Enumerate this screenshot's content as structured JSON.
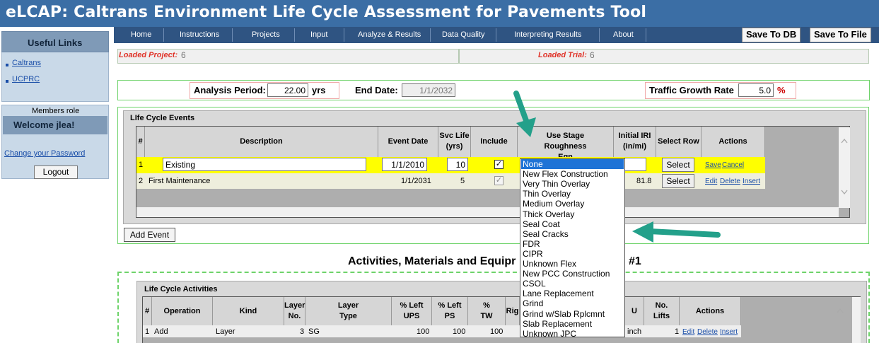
{
  "app": {
    "title": "eLCAP: Caltrans Environment Life Cycle Assessment for Pavements Tool"
  },
  "nav": {
    "items": [
      "Home",
      "Instructions",
      "Projects",
      "Input",
      "Analyze & Results",
      "Data Quality",
      "Interpreting Results",
      "About"
    ],
    "save_db": "Save To DB",
    "save_file": "Save To File"
  },
  "sidebar": {
    "useful_links_title": "Useful Links",
    "links": [
      "Caltrans",
      "UCPRC"
    ],
    "members_role": "Members role",
    "welcome": "Welcome jlea!",
    "change_password": "Change your Password",
    "logout": "Logout"
  },
  "loaded": {
    "project_label": "Loaded Project:",
    "project_value": "6",
    "trial_label": "Loaded Trial:",
    "trial_value": "6"
  },
  "analysis": {
    "period_label": "Analysis Period:",
    "period_value": "22.00",
    "period_unit": "yrs",
    "end_date_label": "End Date:",
    "end_date_value": "1/1/2032",
    "growth_label": "Traffic Growth Rate",
    "growth_value": "5.0",
    "growth_unit": "%"
  },
  "events": {
    "legend": "LIfe Cycle Events",
    "headers": {
      "num": "#",
      "description": "Description",
      "event_date": "Event Date",
      "svc_life": "Svc Life (yrs)",
      "include": "Include",
      "roughness": "Use Stage Roughness Eqn",
      "iri": "Initial IRI (in/mi)",
      "select_row": "Select Row",
      "actions": "Actions"
    },
    "rows": [
      {
        "num": "1",
        "description": "Existing",
        "date": "1/1/2010",
        "svc": "10",
        "include": "✓",
        "select": "Select",
        "actions": [
          "Save",
          "Cancel"
        ]
      },
      {
        "num": "2",
        "description": "First Maintenance",
        "date": "1/1/2031",
        "svc": "5",
        "include": "✓",
        "iri": "81.8",
        "select": "Select",
        "actions": [
          "Edit",
          "Delete",
          "Insert"
        ]
      }
    ],
    "add_event": "Add Event"
  },
  "roughness_dropdown": {
    "selected": "None",
    "options": [
      "None",
      "New Flex Construction",
      "Very Thin Overlay",
      "Thin Overlay",
      "Medium Overlay",
      "Thick Overlay",
      "Seal Coat",
      "Seal Cracks",
      "FDR",
      "CIPR",
      "Unknown Flex",
      "New PCC Construction",
      "CSOL",
      "Lane Replacement",
      "Grind",
      "Grind w/Slab Rplcmnt",
      "Slab Replacement",
      "Unknown JPC"
    ]
  },
  "activities": {
    "title_left": "Activities, Materials and Equipr",
    "title_right": "#1",
    "legend": "Life Cycle Activities",
    "headers": {
      "num": "#",
      "operation": "Operation",
      "kind": "Kind",
      "layer_no": "Layer No.",
      "layer_type": "Layer Type",
      "left_ups": "% Left UPS",
      "left_ps": "% Left PS",
      "tw": "% TW",
      "rig": "Rig",
      "u": "U",
      "lifts": "No. Lifts",
      "actions": "Actions"
    },
    "row": {
      "num": "1",
      "operation": "Add",
      "kind": "Layer",
      "layer_no": "3",
      "layer_type": "SG",
      "left_ups": "100",
      "left_ps": "100",
      "tw": "100",
      "unit": "inch",
      "lifts": "1",
      "actions": [
        "Edit",
        "Delete",
        "Insert"
      ]
    }
  },
  "colors": {
    "header_blue": "#3b6ea5",
    "nav_blue": "#2f5482",
    "arrow_teal": "#23a08a",
    "highlight_yellow": "#ffff00"
  }
}
